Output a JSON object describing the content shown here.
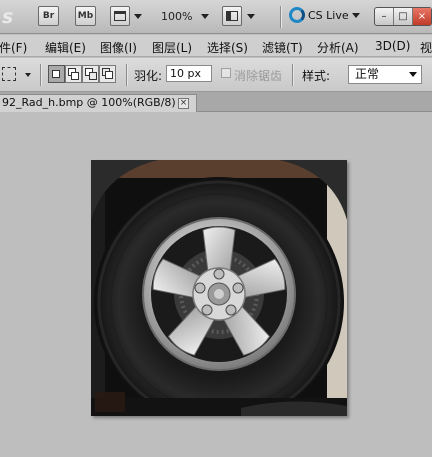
{
  "app_bar": {
    "logo_text": "s",
    "bridge_label": "Br",
    "minibridge_label": "Mb",
    "zoom_level": "100%",
    "cs_live_label": "CS Live",
    "window_controls": {
      "minimize": "–",
      "restore": "□",
      "close": "×"
    }
  },
  "menu": {
    "items": [
      {
        "label": "文件(F)"
      },
      {
        "label": "编辑(E)"
      },
      {
        "label": "图像(I)"
      },
      {
        "label": "图层(L)"
      },
      {
        "label": "选择(S)"
      },
      {
        "label": "滤镜(T)"
      },
      {
        "label": "分析(A)"
      },
      {
        "label": "3D(D)"
      },
      {
        "label": "视"
      }
    ]
  },
  "options_bar": {
    "feather_label": "羽化:",
    "feather_value": "10 px",
    "anti_alias_label": "消除锯齿",
    "anti_alias_checked": false,
    "style_label": "样式:",
    "style_value": "正常"
  },
  "document": {
    "tab_title": "92_Rad_h.bmp @ 100%(RGB/8)",
    "close_label": "×"
  },
  "colors": {
    "accent": "#1e88c7",
    "workspace": "#bebebe",
    "tire": "#1a1a1a",
    "rim": "#c8c8c8"
  }
}
